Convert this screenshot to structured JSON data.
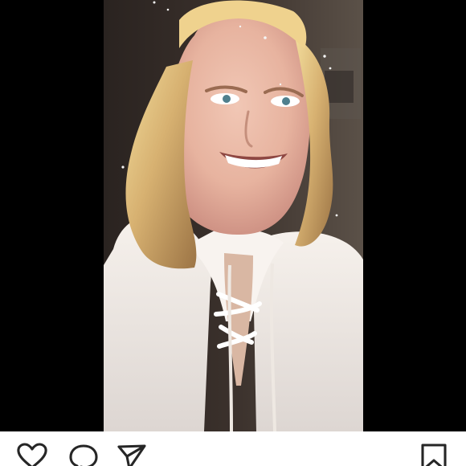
{
  "post": {
    "image_subject": "selfie-photo"
  },
  "actions": {
    "like_icon": "heart-outline-icon",
    "comment_icon": "comment-bubble-icon",
    "share_icon": "paper-plane-icon",
    "save_icon": "bookmark-outline-icon"
  },
  "colors": {
    "background": "#ffffff",
    "letterbox": "#000000",
    "icon_stroke": "#262626"
  }
}
